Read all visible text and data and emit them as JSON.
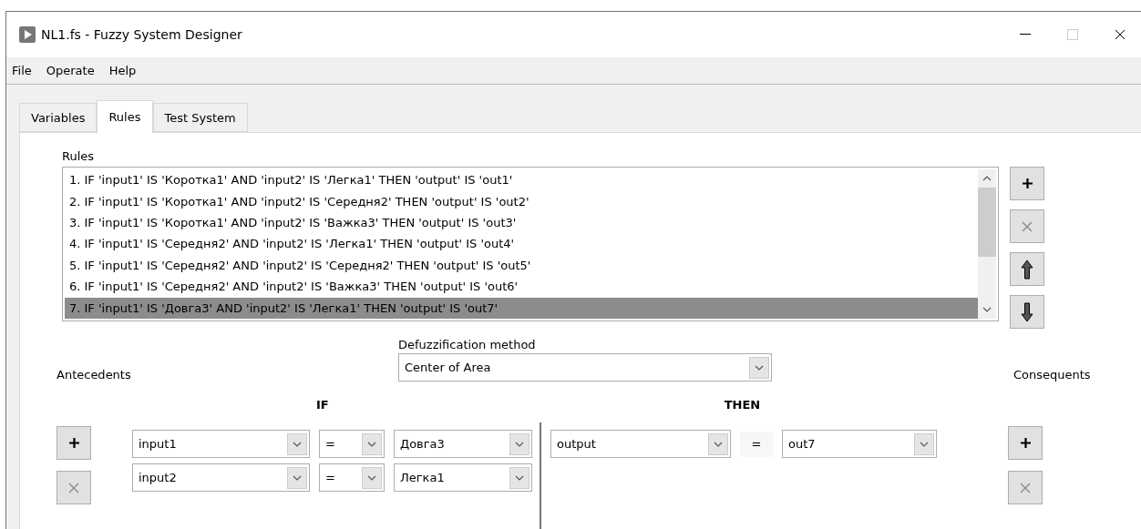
{
  "window": {
    "title": "NL1.fs - Fuzzy System Designer"
  },
  "menu": [
    "File",
    "Operate",
    "Help"
  ],
  "tabs": [
    {
      "label": "Variables",
      "selected": false
    },
    {
      "label": "Rules",
      "selected": true
    },
    {
      "label": "Test System",
      "selected": false
    }
  ],
  "rules": {
    "label": "Rules",
    "items": [
      {
        "text": "1. IF 'input1' IS 'Коротка1' AND 'input2' IS 'Легка1' THEN 'output' IS 'out1'",
        "selected": false
      },
      {
        "text": "2. IF 'input1' IS 'Коротка1' AND 'input2' IS 'Середня2' THEN 'output' IS 'out2'",
        "selected": false
      },
      {
        "text": "3. IF 'input1' IS 'Коротка1' AND 'input2' IS 'Важка3' THEN 'output' IS 'out3'",
        "selected": false
      },
      {
        "text": "4. IF 'input1' IS 'Середня2' AND 'input2' IS 'Легка1' THEN 'output' IS 'out4'",
        "selected": false
      },
      {
        "text": "5. IF 'input1' IS 'Середня2' AND 'input2' IS 'Середня2' THEN 'output' IS 'out5'",
        "selected": false
      },
      {
        "text": "6. IF 'input1' IS 'Середня2' AND 'input2' IS 'Важка3' THEN 'output' IS 'out6'",
        "selected": false
      },
      {
        "text": "7. IF 'input1' IS 'Довга3' AND 'input2' IS 'Легка1' THEN 'output' IS 'out7'",
        "selected": true
      }
    ],
    "buttons": [
      {
        "kind": "add",
        "disabled": false
      },
      {
        "kind": "delete",
        "disabled": true
      },
      {
        "kind": "up",
        "disabled": false
      },
      {
        "kind": "down",
        "disabled": false
      }
    ]
  },
  "defuzzification": {
    "label": "Defuzzification method",
    "value": "Center of Area"
  },
  "antecedents": {
    "label": "Antecedents",
    "heading": "IF",
    "rows": [
      {
        "variable": "input1",
        "operator": "=",
        "term": "Довга3"
      },
      {
        "variable": "input2",
        "operator": "=",
        "term": "Легка1"
      }
    ],
    "buttons": [
      {
        "kind": "add",
        "disabled": false
      },
      {
        "kind": "delete",
        "disabled": true
      }
    ]
  },
  "consequents": {
    "label": "Consequents",
    "heading": "THEN",
    "rows": [
      {
        "variable": "output",
        "operator": "=",
        "term": "out7"
      }
    ],
    "buttons": [
      {
        "kind": "add",
        "disabled": false
      },
      {
        "kind": "delete",
        "disabled": true
      }
    ]
  }
}
